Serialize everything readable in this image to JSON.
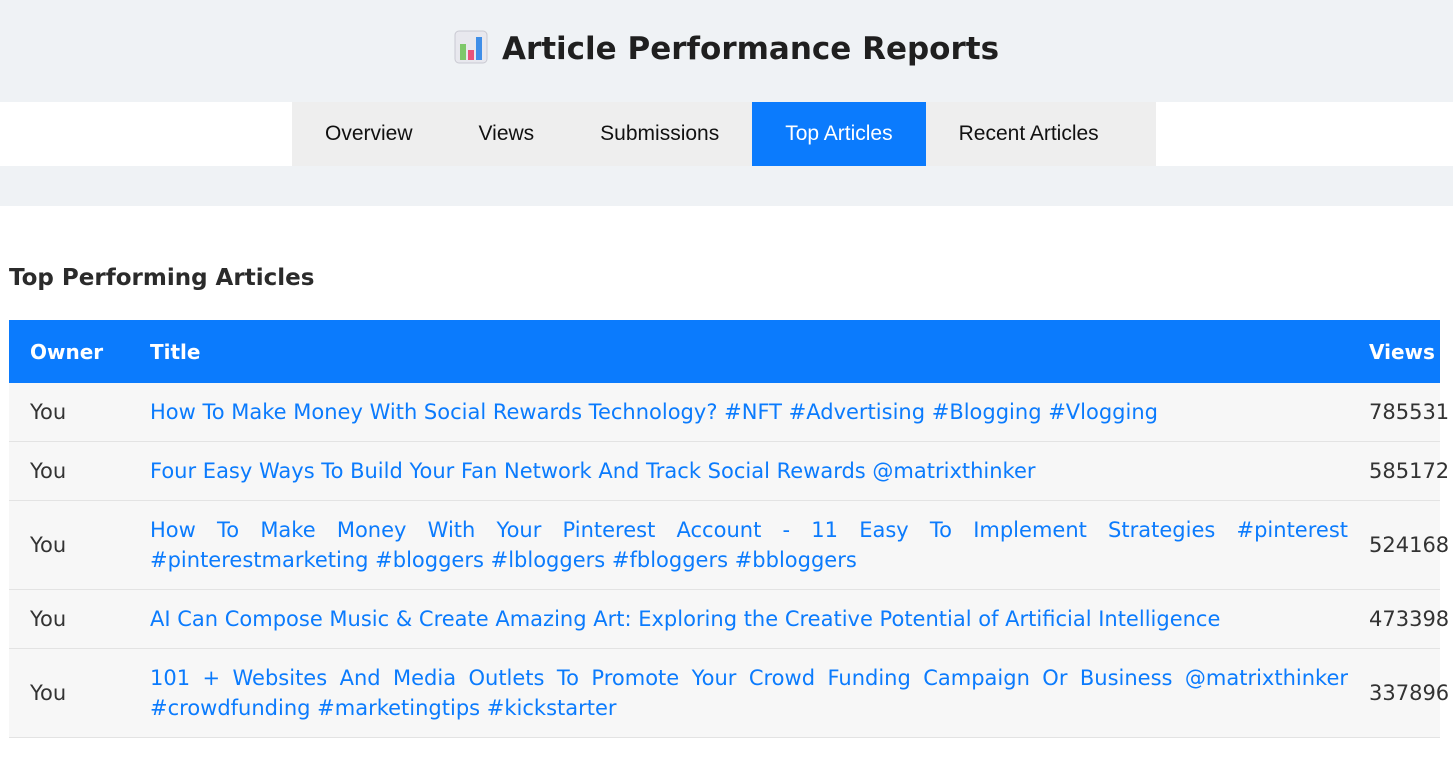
{
  "header": {
    "title": "Article Performance Reports",
    "icon": "bar-chart-icon",
    "bg_color": "#eff2f5"
  },
  "tabs": [
    {
      "label": "Overview",
      "active": false
    },
    {
      "label": "Views",
      "active": false
    },
    {
      "label": "Submissions",
      "active": false
    },
    {
      "label": "Top Articles",
      "active": true
    },
    {
      "label": "Recent Articles",
      "active": false
    }
  ],
  "accent_color": "#0b7bfd",
  "section": {
    "title": "Top Performing Articles"
  },
  "table": {
    "columns": [
      "Owner",
      "Title",
      "Views"
    ],
    "rows": [
      {
        "owner": "You",
        "title": "How To Make Money With Social Rewards Technology? #NFT #Advertising #Blogging #Vlogging",
        "views": "785531"
      },
      {
        "owner": "You",
        "title": "Four Easy Ways To Build Your Fan Network And Track Social Rewards @matrixthinker",
        "views": "585172"
      },
      {
        "owner": "You",
        "title": "How To Make Money With Your Pinterest Account - 11 Easy To Implement Strategies #pinterest #pinterestmarketing #bloggers #lbloggers #fbloggers #bbloggers",
        "views": "524168"
      },
      {
        "owner": "You",
        "title": "AI Can Compose Music & Create Amazing Art: Exploring the Creative Potential of Artificial Intelligence",
        "views": "473398"
      },
      {
        "owner": "You",
        "title": "101 + Websites And Media Outlets To Promote Your Crowd Funding Campaign Or Business @matrixthinker #crowdfunding #marketingtips #kickstarter",
        "views": "337896"
      }
    ]
  }
}
